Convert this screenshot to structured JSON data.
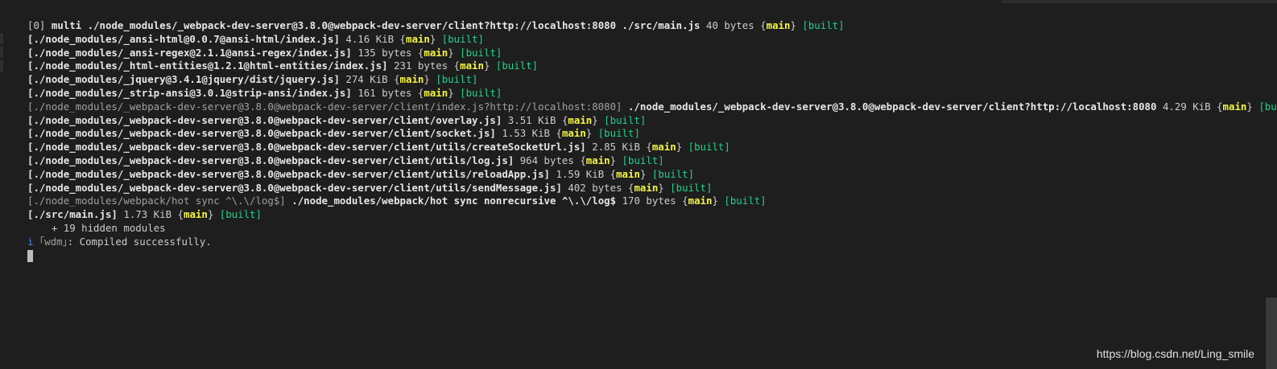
{
  "terminal": {
    "lines": [
      {
        "type": "header",
        "id": "[0]",
        "name": "multi ./node_modules/_webpack-dev-server@3.8.0@webpack-dev-server/client?http://localhost:8080 ./src/main.js",
        "size": "40 bytes",
        "chunk": "main",
        "status": "[built]"
      },
      {
        "type": "module",
        "path": "[./node_modules/_ansi-html@0.0.7@ansi-html/index.js]",
        "size": "4.16 KiB",
        "chunk": "main",
        "status": "[built]"
      },
      {
        "type": "module",
        "path": "[./node_modules/_ansi-regex@2.1.1@ansi-regex/index.js]",
        "size": "135 bytes",
        "chunk": "main",
        "status": "[built]"
      },
      {
        "type": "module",
        "path": "[./node_modules/_html-entities@1.2.1@html-entities/index.js]",
        "size": "231 bytes",
        "chunk": "main",
        "status": "[built]"
      },
      {
        "type": "module",
        "path": "[./node_modules/_jquery@3.4.1@jquery/dist/jquery.js]",
        "size": "274 KiB",
        "chunk": "main",
        "status": "[built]"
      },
      {
        "type": "module",
        "path": "[./node_modules/_strip-ansi@3.0.1@strip-ansi/index.js]",
        "size": "161 bytes",
        "chunk": "main",
        "status": "[built]"
      },
      {
        "type": "module-named",
        "path": "[./node_modules/_webpack-dev-server@3.8.0@webpack-dev-server/client/index.js?http://localhost:8080]",
        "name": "./node_modules/_webpack-dev-server@3.8.0@webpack-dev-server/client?http://localhost:8080",
        "size": "4.29 KiB",
        "chunk": "main",
        "status": "[built]"
      },
      {
        "type": "module",
        "path": "[./node_modules/_webpack-dev-server@3.8.0@webpack-dev-server/client/overlay.js]",
        "size": "3.51 KiB",
        "chunk": "main",
        "status": "[built]"
      },
      {
        "type": "module",
        "path": "[./node_modules/_webpack-dev-server@3.8.0@webpack-dev-server/client/socket.js]",
        "size": "1.53 KiB",
        "chunk": "main",
        "status": "[built]"
      },
      {
        "type": "module",
        "path": "[./node_modules/_webpack-dev-server@3.8.0@webpack-dev-server/client/utils/createSocketUrl.js]",
        "size": "2.85 KiB",
        "chunk": "main",
        "status": "[built]"
      },
      {
        "type": "module",
        "path": "[./node_modules/_webpack-dev-server@3.8.0@webpack-dev-server/client/utils/log.js]",
        "size": "964 bytes",
        "chunk": "main",
        "status": "[built]"
      },
      {
        "type": "module",
        "path": "[./node_modules/_webpack-dev-server@3.8.0@webpack-dev-server/client/utils/reloadApp.js]",
        "size": "1.59 KiB",
        "chunk": "main",
        "status": "[built]"
      },
      {
        "type": "module",
        "path": "[./node_modules/_webpack-dev-server@3.8.0@webpack-dev-server/client/utils/sendMessage.js]",
        "size": "402 bytes",
        "chunk": "main",
        "status": "[built]"
      },
      {
        "type": "module-named",
        "path": "[./node_modules/webpack/hot sync ^\\.\\/log$]",
        "name": "./node_modules/webpack/hot sync nonrecursive ^\\.\\/log$",
        "size": "170 bytes",
        "chunk": "main",
        "status": "[built]"
      },
      {
        "type": "module",
        "path": "[./src/main.js]",
        "size": "1.73 KiB",
        "chunk": "main",
        "status": "[built]"
      },
      {
        "type": "hidden",
        "text": "    + 19 hidden modules"
      },
      {
        "type": "info",
        "icon": "i",
        "tag": "｢wdm｣",
        "message": ": Compiled successfully."
      }
    ]
  },
  "watermark": "https://blog.csdn.net/Ling_smile",
  "colors": {
    "background": "#1e1e1e",
    "chunk": "#f5f543",
    "built": "#23d18b",
    "info_icon": "#3b8eea"
  }
}
